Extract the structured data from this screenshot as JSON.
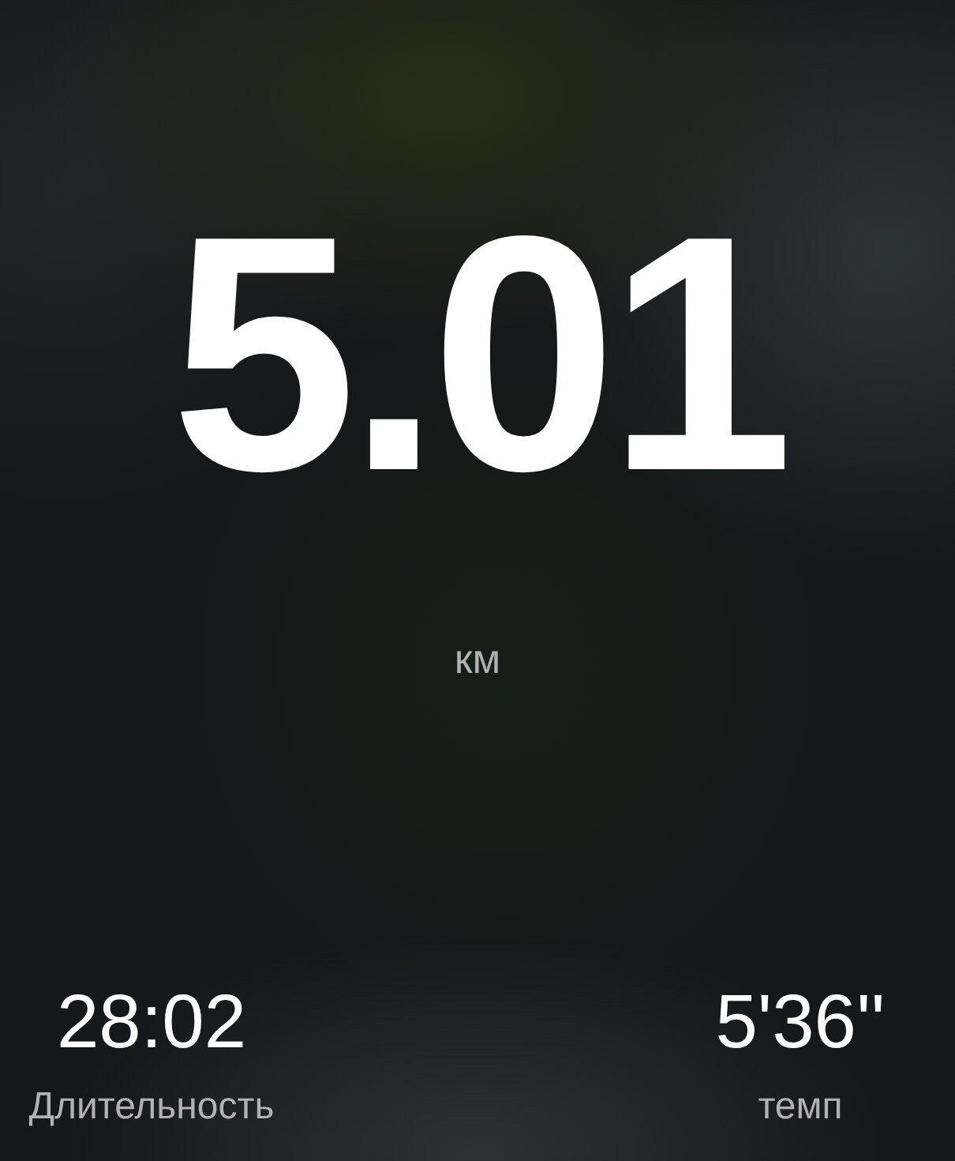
{
  "distance": {
    "value": "5.01",
    "unit": "км"
  },
  "stats": [
    {
      "value": "28:02",
      "label": "Длительность"
    },
    {
      "value": "5'36''",
      "label": "темп"
    }
  ]
}
